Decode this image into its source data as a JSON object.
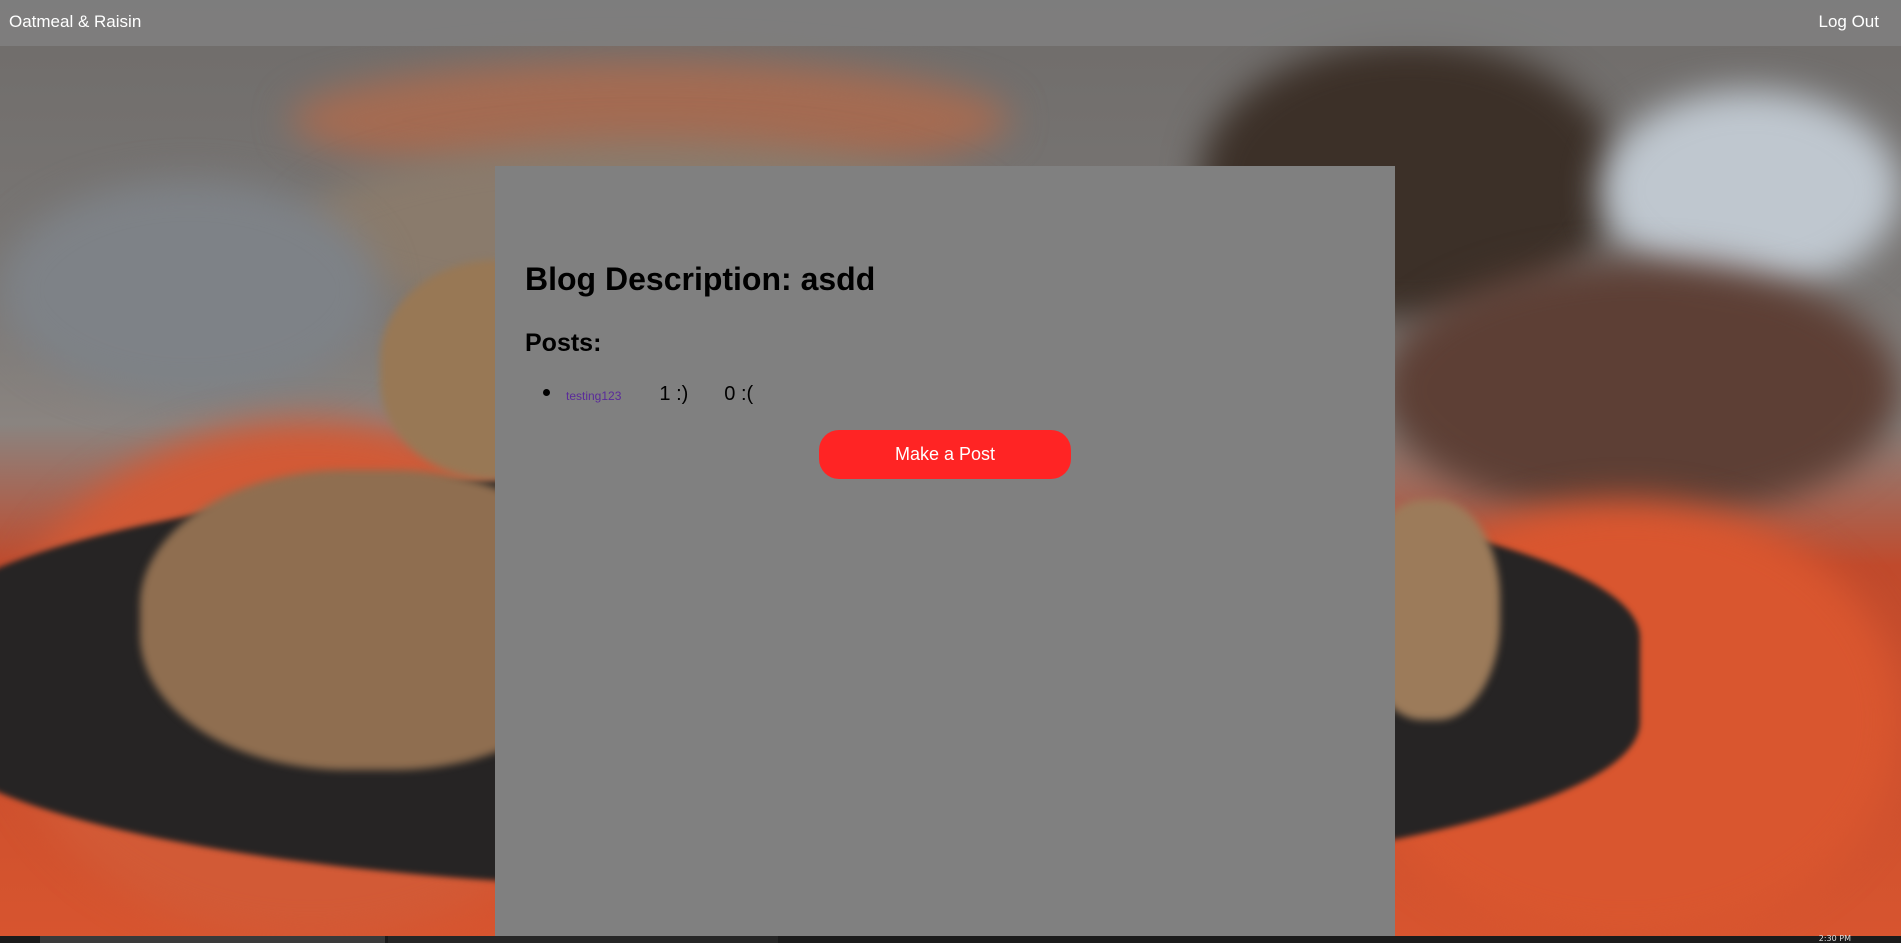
{
  "navbar": {
    "brand": "Oatmeal & Raisin",
    "logout": "Log Out"
  },
  "main": {
    "title": "Blog Description: asdd",
    "posts_heading": "Posts:",
    "posts": [
      {
        "title": "testing123",
        "likes": "1 :)",
        "dislikes": "0 :("
      }
    ],
    "make_post_label": "Make a Post"
  },
  "colors": {
    "navbar_bg": "#808080",
    "panel_bg": "#808080",
    "button_bg": "#ff2424",
    "link": "#5a2a9a"
  },
  "taskbar": {
    "clock": "2:30 PM"
  }
}
